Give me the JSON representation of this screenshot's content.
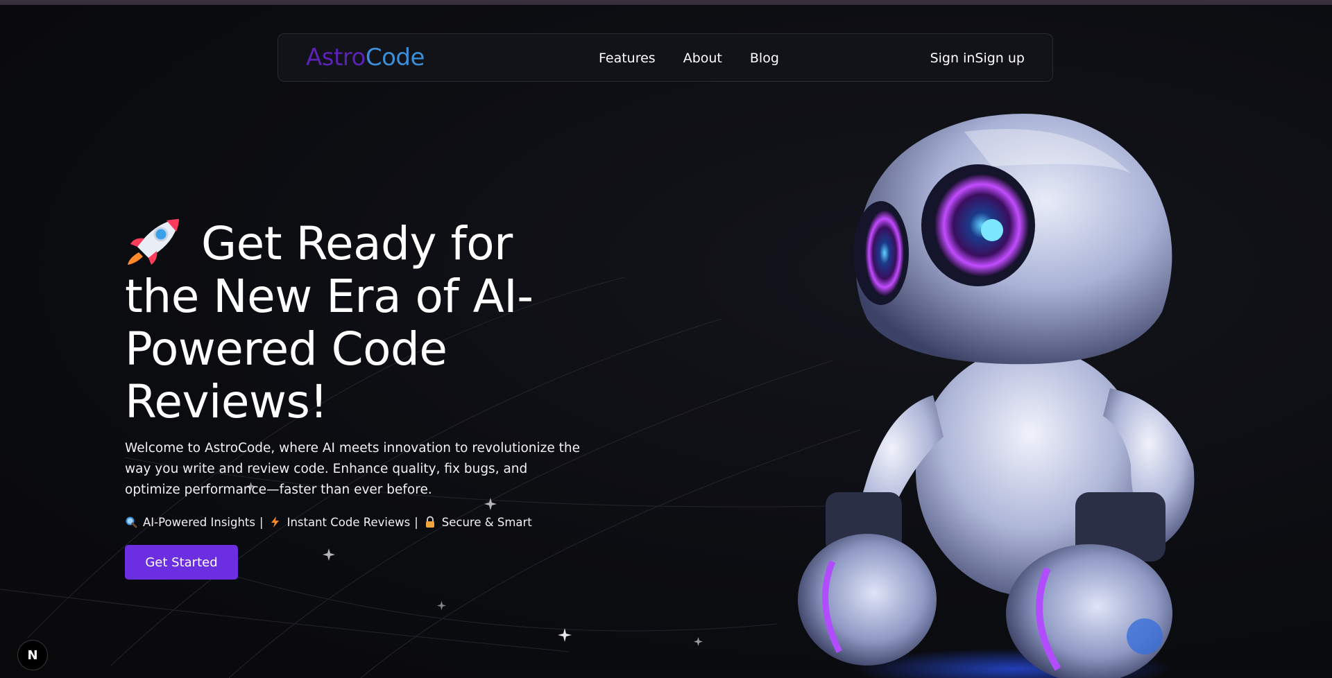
{
  "nav": {
    "logo_part1": "Astro",
    "logo_part2": "Code",
    "links": [
      "Features",
      "About",
      "Blog"
    ],
    "sign_in": "Sign in",
    "sign_up": "Sign up"
  },
  "hero": {
    "title": "Get Ready for the New Era of AI-Powered Code Reviews!",
    "description": "Welcome to AstroCode, where AI meets innovation to revolutionize the way you write and review code. Enhance quality, fix bugs, and optimize performance—faster than ever before.",
    "features": [
      {
        "icon": "magnifier-icon",
        "label": "AI-Powered Insights"
      },
      {
        "icon": "lightning-icon",
        "label": "Instant Code Reviews"
      },
      {
        "icon": "lock-icon",
        "label": "Secure & Smart"
      }
    ],
    "separator": "|",
    "cta_label": "Get Started"
  },
  "badge": {
    "label": "N"
  },
  "colors": {
    "background": "#0b0c10",
    "logo_purple": "#5b22b5",
    "logo_blue": "#3a8fd8",
    "cta": "#6b2ee0"
  }
}
